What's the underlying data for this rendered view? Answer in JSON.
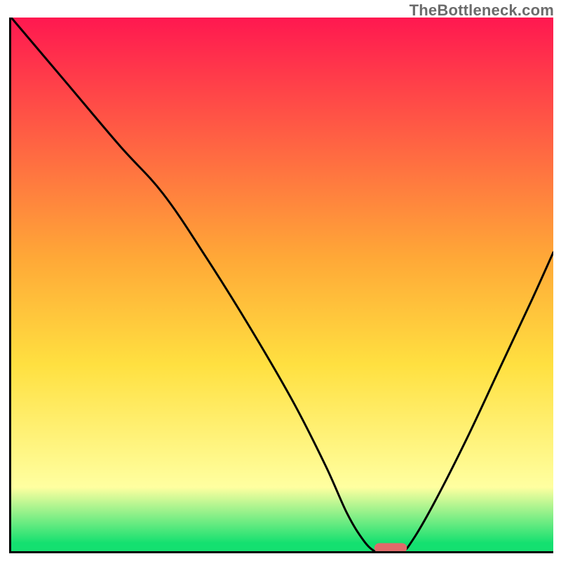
{
  "watermark": "TheBottleneck.com",
  "colors": {
    "gradient_top": "#ff1850",
    "gradient_orange": "#ffa837",
    "gradient_yellow": "#ffe040",
    "gradient_lightyellow": "#ffffa0",
    "gradient_green": "#14e070",
    "curve_stroke": "#000000",
    "marker_fill": "#e06a6a"
  },
  "chart_data": {
    "type": "line",
    "title": "",
    "xlabel": "",
    "ylabel": "",
    "xlim": [
      0,
      100
    ],
    "ylim": [
      0,
      100
    ],
    "series": [
      {
        "name": "bottleneck-curve",
        "x": [
          0,
          10,
          20,
          28,
          36,
          44,
          52,
          58,
          62,
          65,
          67,
          68,
          72,
          74,
          78,
          84,
          90,
          96,
          100
        ],
        "y": [
          100,
          88,
          76,
          67,
          55,
          42,
          28,
          16,
          7,
          2,
          0,
          0,
          0,
          2,
          9,
          21,
          34,
          47,
          56
        ]
      }
    ],
    "optimum_marker": {
      "x_center": 70,
      "x_width": 6,
      "y": 0.6
    },
    "gradient_stops": [
      {
        "offset": 0.0,
        "color_key": "gradient_top"
      },
      {
        "offset": 0.45,
        "color_key": "gradient_orange"
      },
      {
        "offset": 0.65,
        "color_key": "gradient_yellow"
      },
      {
        "offset": 0.88,
        "color_key": "gradient_lightyellow"
      },
      {
        "offset": 0.985,
        "color_key": "gradient_green"
      },
      {
        "offset": 1.0,
        "color_key": "gradient_green"
      }
    ]
  }
}
